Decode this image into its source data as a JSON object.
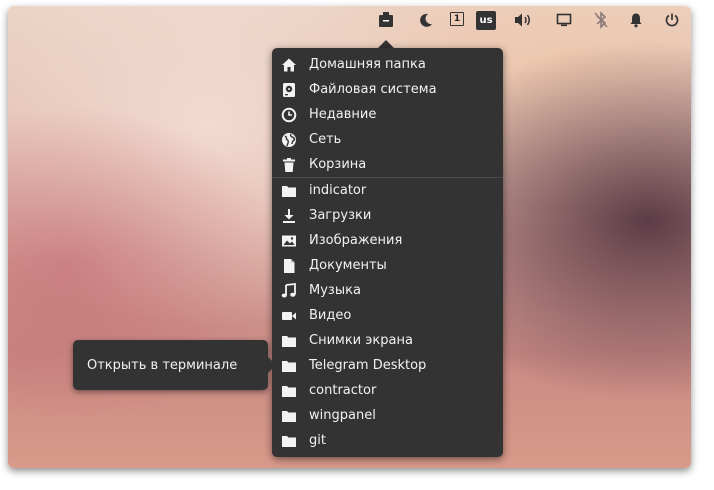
{
  "panel": {
    "indicators": [
      {
        "name": "places-icon"
      },
      {
        "name": "night-light-icon"
      },
      {
        "name": "workspace-icon"
      },
      {
        "name": "keyboard-icon"
      },
      {
        "name": "volume-icon"
      },
      {
        "name": "display-icon"
      },
      {
        "name": "bluetooth-disabled-icon"
      },
      {
        "name": "notifications-icon"
      },
      {
        "name": "power-icon"
      }
    ],
    "workspace_number": "1",
    "keyboard_layout": "us"
  },
  "menu": {
    "places": [
      {
        "label": "Домашняя папка",
        "icon": "home-icon"
      },
      {
        "label": "Файловая система",
        "icon": "drive-icon"
      },
      {
        "label": "Недавние",
        "icon": "clock-icon"
      },
      {
        "label": "Сеть",
        "icon": "globe-icon"
      },
      {
        "label": "Корзина",
        "icon": "trash-icon"
      }
    ],
    "bookmarks": [
      {
        "label": "indicator",
        "icon": "folder-icon"
      },
      {
        "label": "Загрузки",
        "icon": "download-icon"
      },
      {
        "label": "Изображения",
        "icon": "image-icon"
      },
      {
        "label": "Документы",
        "icon": "document-icon"
      },
      {
        "label": "Музыка",
        "icon": "music-icon"
      },
      {
        "label": "Видео",
        "icon": "video-icon"
      },
      {
        "label": "Снимки экрана",
        "icon": "folder-icon"
      },
      {
        "label": "Telegram Desktop",
        "icon": "folder-icon"
      },
      {
        "label": "contractor",
        "icon": "folder-icon"
      },
      {
        "label": "wingpanel",
        "icon": "folder-icon"
      },
      {
        "label": "git",
        "icon": "folder-icon"
      }
    ]
  },
  "tooltip": {
    "text": "Открыть в терминале"
  },
  "colors": {
    "menu_bg": "#333333",
    "menu_text": "#f2f2f2",
    "panel_icon": "#333333"
  }
}
